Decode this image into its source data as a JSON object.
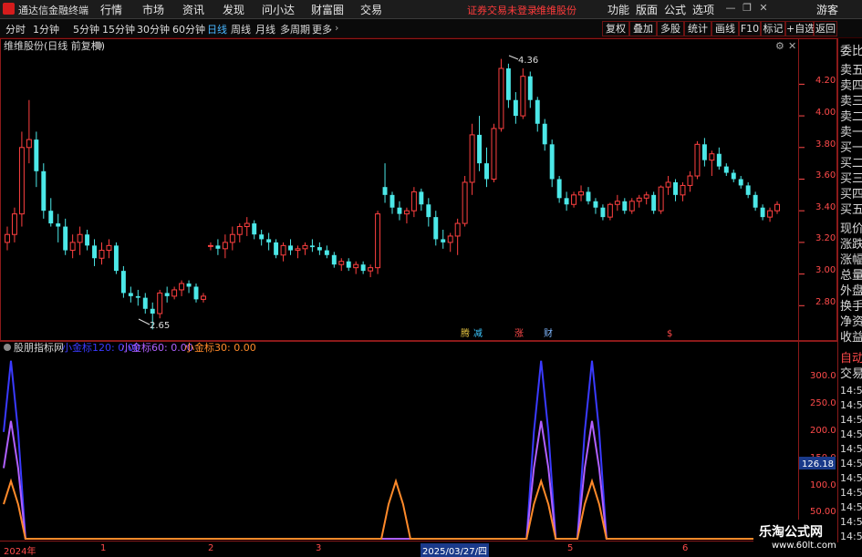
{
  "app": {
    "title": "通达信金融终端"
  },
  "menus": [
    "行情",
    "市场",
    "资讯",
    "发现",
    "问小达",
    "财富圈",
    "交易"
  ],
  "status": [
    "证券交易未登录",
    "维维股份"
  ],
  "right_menus": [
    "功能",
    "版面",
    "公式",
    "选项"
  ],
  "guest": "游客",
  "periods": [
    "分时",
    "1分钟",
    "5分钟",
    "15分钟",
    "30分钟",
    "60分钟",
    "日线",
    "周线",
    "月线",
    "多周期",
    "更多"
  ],
  "active_period": "日线",
  "tool_buttons": [
    "复权",
    "叠加",
    "多股",
    "统计",
    "画线",
    "F10",
    "标记",
    "+自选",
    "返回"
  ],
  "main_title": "维维股份(日线 前复权)",
  "price_axis": [
    "4.20",
    "4.00",
    "3.80",
    "3.60",
    "3.40",
    "3.20",
    "3.00",
    "2.80"
  ],
  "high_label": "4.36",
  "low_label": "2.65",
  "event_tags": [
    {
      "text": "腾",
      "color": "#e0c040"
    },
    {
      "text": "减",
      "color": "#3cc7ff"
    },
    {
      "text": "涨",
      "color": "#ff4a4a"
    },
    {
      "text": "财",
      "color": "#7fb8ff"
    },
    {
      "text": "$",
      "color": "#ff4a4a"
    }
  ],
  "indicator": {
    "name": "股朋指标网",
    "lines": [
      {
        "label": "小金标120: 0.00",
        "color": "#3a3aff"
      },
      {
        "label": "小金标60: 0.00",
        "color": "#b060ff"
      },
      {
        "label": "小金标30: 0.00",
        "color": "#ff8a2a"
      }
    ],
    "axis": [
      "300.0",
      "250.0",
      "200.0",
      "150.0",
      "100.0",
      "50.00"
    ],
    "current_value": "126.18"
  },
  "dates": [
    "2024年",
    "1",
    "2",
    "3",
    "2025/03/27/四",
    "5",
    "6"
  ],
  "right_panel": [
    "委比",
    "卖五",
    "卖四",
    "卖三",
    "卖二",
    "卖一",
    "买一",
    "买二",
    "买三",
    "买四",
    "买五",
    "现价",
    "涨跌",
    "涨幅",
    "总量",
    "外盘",
    "换手",
    "净资",
    "收益"
  ],
  "right_panel_lower": [
    "自动",
    "交易"
  ],
  "times": [
    "14:56",
    "14:56",
    "14:56",
    "14:56",
    "14:56",
    "14:56",
    "14:56",
    "14:56",
    "14:56",
    "14:56",
    "14:56"
  ],
  "watermark": {
    "name": "乐淘公式网",
    "url": "www.60lt.com"
  },
  "colors": {
    "up": "#ff4040",
    "down": "#4ce8e8",
    "grid": "#8a1a1a",
    "active": "#48b6ff"
  },
  "chart_data": {
    "type": "candlestick",
    "title": "维维股份(日线 前复权)",
    "ylim": [
      2.6,
      4.45
    ],
    "candles": [
      [
        3.2,
        3.3,
        3.15,
        3.25
      ],
      [
        3.25,
        3.42,
        3.2,
        3.38
      ],
      [
        3.38,
        3.9,
        3.3,
        3.8
      ],
      [
        3.8,
        4.1,
        3.7,
        3.85
      ],
      [
        3.85,
        3.9,
        3.55,
        3.65
      ],
      [
        3.65,
        3.7,
        3.35,
        3.4
      ],
      [
        3.4,
        3.48,
        3.3,
        3.32
      ],
      [
        3.32,
        3.38,
        3.2,
        3.3
      ],
      [
        3.3,
        3.35,
        3.12,
        3.15
      ],
      [
        3.15,
        3.25,
        3.1,
        3.2
      ],
      [
        3.2,
        3.3,
        3.12,
        3.25
      ],
      [
        3.25,
        3.28,
        3.15,
        3.18
      ],
      [
        3.18,
        3.22,
        3.05,
        3.1
      ],
      [
        3.1,
        3.2,
        3.06,
        3.15
      ],
      [
        3.15,
        3.22,
        3.1,
        3.18
      ],
      [
        3.18,
        3.2,
        3.0,
        3.02
      ],
      [
        3.02,
        3.05,
        2.85,
        2.88
      ],
      [
        2.88,
        2.92,
        2.82,
        2.86
      ],
      [
        2.86,
        2.9,
        2.8,
        2.85
      ],
      [
        2.85,
        2.88,
        2.75,
        2.78
      ],
      [
        2.78,
        2.82,
        2.65,
        2.75
      ],
      [
        2.75,
        2.9,
        2.72,
        2.88
      ],
      [
        2.88,
        2.92,
        2.82,
        2.86
      ],
      [
        2.86,
        2.92,
        2.84,
        2.9
      ],
      [
        2.9,
        2.96,
        2.86,
        2.94
      ],
      [
        2.94,
        2.96,
        2.88,
        2.92
      ],
      [
        2.92,
        2.94,
        2.82,
        2.84
      ],
      [
        2.84,
        2.88,
        2.82,
        2.86
      ],
      [
        3.18,
        3.2,
        3.15,
        3.18
      ],
      [
        3.18,
        3.22,
        3.12,
        3.16
      ],
      [
        3.16,
        3.25,
        3.1,
        3.2
      ],
      [
        3.2,
        3.3,
        3.15,
        3.25
      ],
      [
        3.25,
        3.32,
        3.2,
        3.3
      ],
      [
        3.3,
        3.36,
        3.24,
        3.32
      ],
      [
        3.32,
        3.34,
        3.22,
        3.25
      ],
      [
        3.25,
        3.28,
        3.18,
        3.22
      ],
      [
        3.22,
        3.26,
        3.15,
        3.2
      ],
      [
        3.2,
        3.22,
        3.1,
        3.12
      ],
      [
        3.12,
        3.2,
        3.08,
        3.18
      ],
      [
        3.18,
        3.22,
        3.12,
        3.15
      ],
      [
        3.15,
        3.18,
        3.1,
        3.16
      ],
      [
        3.16,
        3.2,
        3.12,
        3.18
      ],
      [
        3.18,
        3.22,
        3.14,
        3.17
      ],
      [
        3.17,
        3.2,
        3.12,
        3.15
      ],
      [
        3.15,
        3.18,
        3.1,
        3.12
      ],
      [
        3.12,
        3.14,
        3.04,
        3.06
      ],
      [
        3.06,
        3.1,
        3.02,
        3.08
      ],
      [
        3.08,
        3.1,
        3.02,
        3.04
      ],
      [
        3.04,
        3.08,
        3.0,
        3.06
      ],
      [
        3.06,
        3.08,
        3.0,
        3.02
      ],
      [
        3.02,
        3.06,
        2.98,
        3.04
      ],
      [
        3.04,
        3.4,
        3.0,
        3.38
      ],
      [
        3.55,
        3.7,
        3.45,
        3.5
      ],
      [
        3.5,
        3.52,
        3.38,
        3.42
      ],
      [
        3.42,
        3.46,
        3.34,
        3.38
      ],
      [
        3.38,
        3.42,
        3.32,
        3.4
      ],
      [
        3.4,
        3.55,
        3.36,
        3.52
      ],
      [
        3.52,
        3.54,
        3.4,
        3.44
      ],
      [
        3.44,
        3.48,
        3.3,
        3.36
      ],
      [
        3.36,
        3.4,
        3.18,
        3.22
      ],
      [
        3.22,
        3.28,
        3.16,
        3.2
      ],
      [
        3.2,
        3.26,
        3.14,
        3.24
      ],
      [
        3.24,
        3.35,
        3.12,
        3.32
      ],
      [
        3.32,
        3.62,
        3.3,
        3.58
      ],
      [
        3.58,
        3.95,
        3.5,
        3.88
      ],
      [
        3.88,
        4.0,
        3.65,
        3.7
      ],
      [
        3.7,
        3.8,
        3.55,
        3.6
      ],
      [
        3.6,
        3.95,
        3.58,
        3.92
      ],
      [
        3.92,
        4.36,
        3.9,
        4.3
      ],
      [
        4.3,
        4.33,
        4.05,
        4.1
      ],
      [
        4.1,
        4.15,
        3.95,
        4.0
      ],
      [
        4.0,
        4.3,
        3.98,
        4.25
      ],
      [
        4.25,
        4.28,
        4.05,
        4.1
      ],
      [
        4.1,
        4.12,
        3.9,
        3.95
      ],
      [
        3.95,
        3.98,
        3.78,
        3.82
      ],
      [
        3.82,
        3.85,
        3.55,
        3.6
      ],
      [
        3.6,
        3.62,
        3.45,
        3.48
      ],
      [
        3.48,
        3.52,
        3.4,
        3.44
      ],
      [
        3.44,
        3.52,
        3.42,
        3.5
      ],
      [
        3.5,
        3.56,
        3.46,
        3.52
      ],
      [
        3.52,
        3.55,
        3.44,
        3.46
      ],
      [
        3.46,
        3.48,
        3.38,
        3.42
      ],
      [
        3.42,
        3.44,
        3.34,
        3.36
      ],
      [
        3.36,
        3.45,
        3.34,
        3.44
      ],
      [
        3.44,
        3.5,
        3.4,
        3.46
      ],
      [
        3.46,
        3.48,
        3.38,
        3.4
      ],
      [
        3.4,
        3.48,
        3.38,
        3.46
      ],
      [
        3.46,
        3.5,
        3.42,
        3.48
      ],
      [
        3.48,
        3.52,
        3.44,
        3.5
      ],
      [
        3.5,
        3.52,
        3.38,
        3.4
      ],
      [
        3.4,
        3.56,
        3.38,
        3.55
      ],
      [
        3.55,
        3.62,
        3.5,
        3.58
      ],
      [
        3.58,
        3.6,
        3.46,
        3.5
      ],
      [
        3.5,
        3.58,
        3.46,
        3.56
      ],
      [
        3.56,
        3.65,
        3.52,
        3.62
      ],
      [
        3.62,
        3.84,
        3.6,
        3.82
      ],
      [
        3.82,
        3.86,
        3.68,
        3.72
      ],
      [
        3.72,
        3.78,
        3.62,
        3.76
      ],
      [
        3.76,
        3.8,
        3.66,
        3.68
      ],
      [
        3.68,
        3.7,
        3.62,
        3.64
      ],
      [
        3.64,
        3.66,
        3.58,
        3.6
      ],
      [
        3.6,
        3.62,
        3.54,
        3.56
      ],
      [
        3.56,
        3.58,
        3.48,
        3.5
      ],
      [
        3.5,
        3.52,
        3.4,
        3.42
      ],
      [
        3.42,
        3.44,
        3.34,
        3.36
      ],
      [
        3.36,
        3.42,
        3.33,
        3.4
      ],
      [
        3.4,
        3.46,
        3.38,
        3.44
      ]
    ],
    "indicator_series": [
      {
        "name": "小金标120",
        "color": "#3a3aff",
        "peak": 340,
        "peaks": [
          1,
          74,
          81
        ]
      },
      {
        "name": "小金标60",
        "color": "#b060ff",
        "peak": 225,
        "peaks": [
          1,
          74,
          81
        ]
      },
      {
        "name": "小金标30",
        "color": "#ff8a2a",
        "peak": 110,
        "peaks": [
          1,
          54,
          74,
          81
        ]
      }
    ],
    "indicator_ylim": [
      0,
      350
    ]
  }
}
